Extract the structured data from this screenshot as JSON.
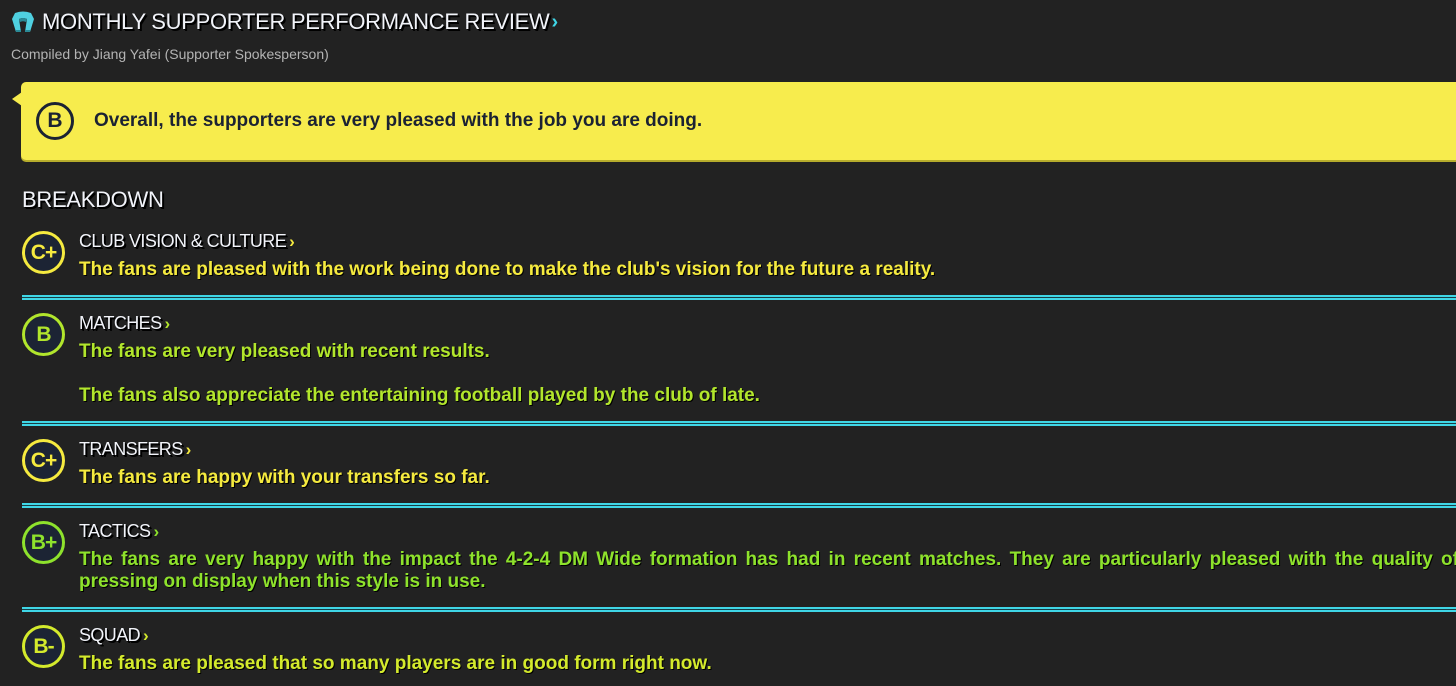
{
  "header": {
    "icon": "scarf-icon",
    "title": "MONTHLY SUPPORTER PERFORMANCE REVIEW",
    "chevron": "›",
    "subtitle": "Compiled by Jiang Yafei (Supporter Spokesperson)"
  },
  "overall": {
    "grade": "B",
    "text": "Overall, the supporters are very pleased with the job you are doing.",
    "banner_color": "#f7ec4d"
  },
  "breakdown": {
    "heading": "BREAKDOWN",
    "sections": [
      {
        "title": "CLUB VISION & CULTURE",
        "grade": "C+",
        "color": "#f5ea3f",
        "paragraphs": [
          "The fans are pleased with the work being done to make the club's vision for the future a reality."
        ]
      },
      {
        "title": "MATCHES",
        "grade": "B",
        "color": "#b2e62c",
        "paragraphs": [
          "The fans are very pleased with recent results.",
          "The fans also appreciate the entertaining football played by the club of late."
        ]
      },
      {
        "title": "TRANSFERS",
        "grade": "C+",
        "color": "#f5ea3f",
        "paragraphs": [
          "The fans are happy with your transfers so far."
        ]
      },
      {
        "title": "TACTICS",
        "grade": "B+",
        "color": "#8ee22c",
        "paragraphs": [
          "The fans are very happy with the impact the 4-2-4 DM Wide formation has had in recent matches. They are particularly pleased with the quality of pressing on display when this style is in use."
        ]
      },
      {
        "title": "SQUAD",
        "grade": "B-",
        "color": "#d4ea2c",
        "paragraphs": [
          "The fans are pleased that so many players are in good form right now."
        ]
      }
    ],
    "chevron": "›",
    "divider_color": "#3fd6e6"
  }
}
